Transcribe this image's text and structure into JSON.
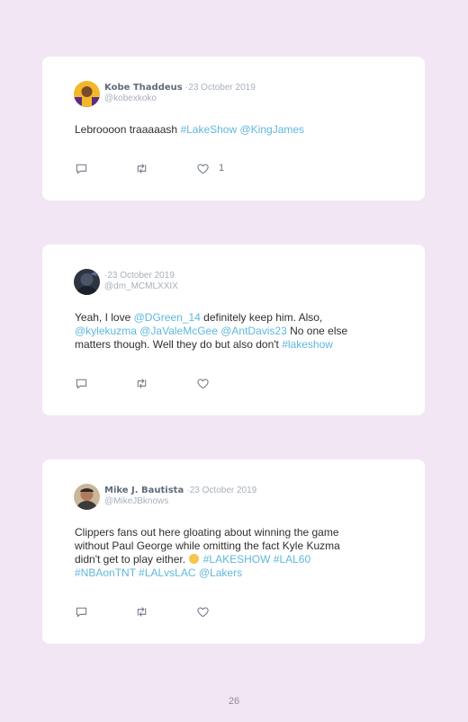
{
  "tweets": [
    {
      "name": "Kobe Thaddeus",
      "separator": "·",
      "date": "23 October 2019",
      "handle": "@kobexkoko",
      "body": [
        {
          "t": "Lebroooon traaaaash ",
          "link": false
        },
        {
          "t": "#LakeShow",
          "link": true
        },
        {
          "t": " ",
          "link": false
        },
        {
          "t": "@KingJames",
          "link": true
        }
      ],
      "like_count": "1"
    },
    {
      "name": "",
      "separator": "·",
      "date": "23 October 2019",
      "handle": "@dm_MCMLXXIX",
      "body": [
        {
          "t": "Yeah, I love ",
          "link": false
        },
        {
          "t": "@DGreen_14",
          "link": true
        },
        {
          "t": " definitely keep him. Also, ",
          "link": false
        },
        {
          "br": true
        },
        {
          "t": "@kylekuzma",
          "link": true
        },
        {
          "t": " ",
          "link": false
        },
        {
          "t": "@JaValeMcGee",
          "link": true
        },
        {
          "t": " ",
          "link": false
        },
        {
          "t": "@AntDavis23",
          "link": true
        },
        {
          "t": " No one else ",
          "link": false
        },
        {
          "br": true
        },
        {
          "t": "matters though. Well they do but also don't ",
          "link": false
        },
        {
          "t": "#lakeshow",
          "link": true
        }
      ],
      "like_count": ""
    },
    {
      "name": "Mike J. Bautista",
      "separator": "·",
      "date": "23 October 2019",
      "handle": "@MikeJBknows",
      "body": [
        {
          "t": "Clippers fans out here gloating about winning the game ",
          "link": false
        },
        {
          "br": true
        },
        {
          "t": "without Paul George while omitting the fact Kyle Kuzma ",
          "link": false
        },
        {
          "br": true
        },
        {
          "t": "didn't get to play either. ",
          "link": false
        },
        {
          "emoji": "yellow-circle"
        },
        {
          "t": " ",
          "link": false
        },
        {
          "t": "#LAKESHOW",
          "link": true
        },
        {
          "t": " ",
          "link": false
        },
        {
          "t": "#LAL60",
          "link": true
        },
        {
          "br": true
        },
        {
          "t": "#NBAonTNT",
          "link": true
        },
        {
          "t": " ",
          "link": false
        },
        {
          "t": "#LALvsLAC",
          "link": true
        },
        {
          "t": " ",
          "link": false
        },
        {
          "t": "@Lakers",
          "link": true
        }
      ],
      "like_count": ""
    }
  ],
  "icons": [
    "reply-icon",
    "retweet-icon",
    "like-icon"
  ],
  "colors": {
    "background": "#f2e6f4",
    "link": "#5fb7dd",
    "card": "#ffffff"
  },
  "page_number": "26"
}
